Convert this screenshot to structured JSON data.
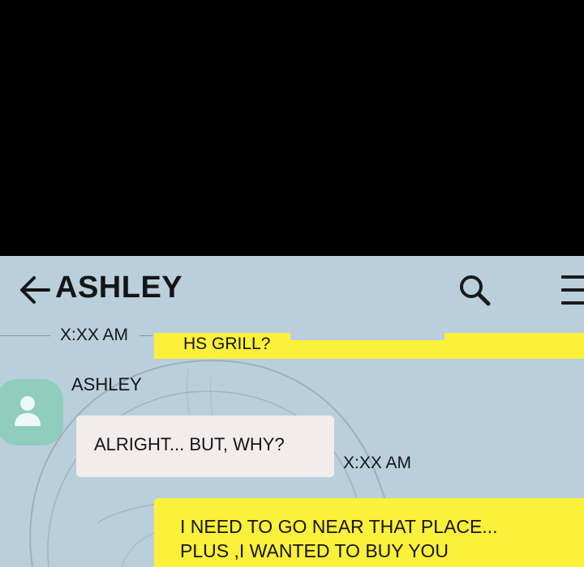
{
  "header": {
    "contact_name": "ASHLEY",
    "back_icon": "arrow-left-icon",
    "search_icon": "search-icon",
    "menu_icon": "menu-icon"
  },
  "messages": [
    {
      "direction": "outgoing",
      "time": "X:XX AM",
      "text": "HS GRILL?"
    },
    {
      "direction": "incoming",
      "sender": "ASHLEY",
      "time": "X:XX AM",
      "text": "ALRIGHT... BUT, WHY?"
    },
    {
      "direction": "outgoing",
      "text": "I NEED TO GO NEAR THAT PLACE...\nPLUS ,I WANTED TO BUY YOU"
    }
  ],
  "colors": {
    "chat_background": "#b9cfdc",
    "outgoing_bubble": "#fbf03a",
    "incoming_bubble": "#f2eced",
    "avatar": "#8fcdbd",
    "letterbox": "#000000"
  }
}
